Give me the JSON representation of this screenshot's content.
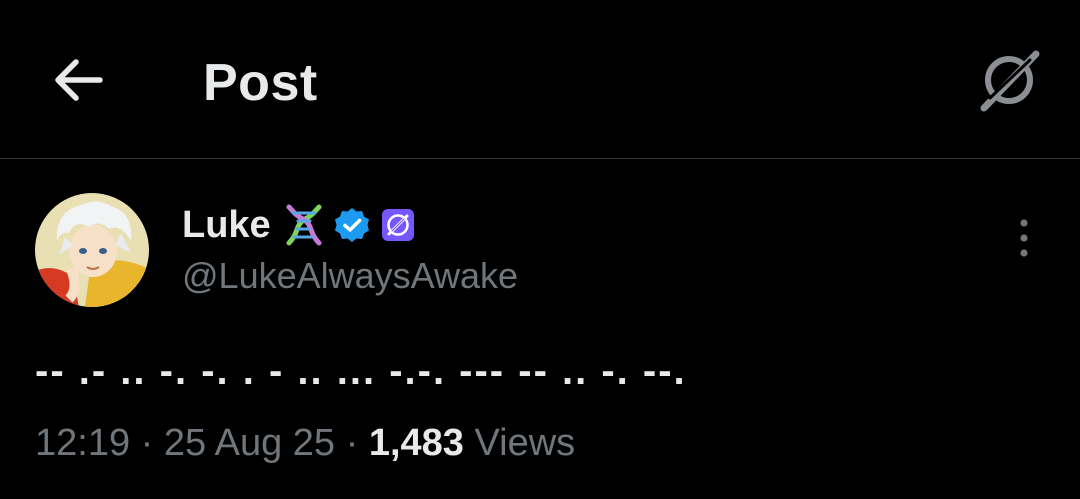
{
  "header": {
    "title": "Post",
    "back_icon": "arrow-left-icon",
    "grok_icon": "grok-icon"
  },
  "post": {
    "author": {
      "display_name": "Luke",
      "handle": "@LukeAlwaysAwake",
      "emoji_icon": "dna-icon",
      "verified_icon": "verified-badge-icon",
      "affiliate_icon": "affiliate-badge-icon"
    },
    "text": "-- .- .. -. -. . - .. ... -.-. --- -- .. -. --.",
    "time": "12:19",
    "separator": "·",
    "date": "25 Aug 25",
    "views_count": "1,483",
    "views_label": "Views"
  },
  "colors": {
    "background": "#000000",
    "text_primary": "#e7e9ea",
    "text_secondary": "#71767b",
    "verified_blue": "#1d9bf0",
    "affiliate_purple": "#7856ff",
    "divider": "#2f3336"
  }
}
